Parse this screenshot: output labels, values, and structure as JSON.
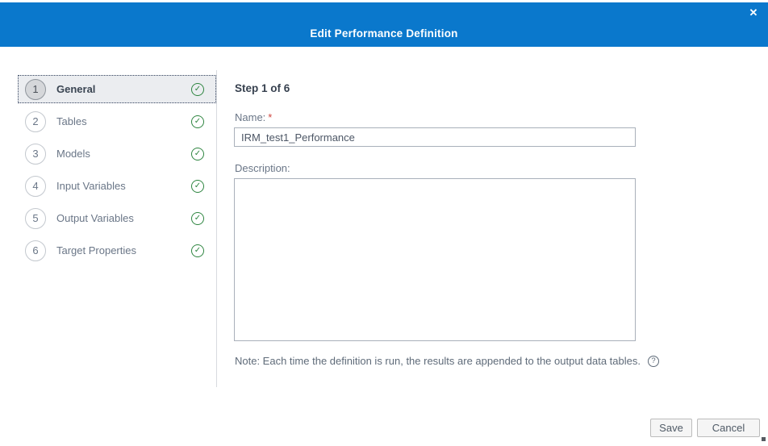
{
  "modal": {
    "title": "Edit Performance Definition",
    "close_icon": "✕"
  },
  "stepper": {
    "check_icon": "✓",
    "steps": [
      {
        "num": "1",
        "label": "General",
        "slug": "general",
        "selected": true
      },
      {
        "num": "2",
        "label": "Tables",
        "slug": "tables",
        "selected": false
      },
      {
        "num": "3",
        "label": "Models",
        "slug": "models",
        "selected": false
      },
      {
        "num": "4",
        "label": "Input Variables",
        "slug": "input-variables",
        "selected": false
      },
      {
        "num": "5",
        "label": "Output Variables",
        "slug": "output-variables",
        "selected": false
      },
      {
        "num": "6",
        "label": "Target Properties",
        "slug": "target-properties",
        "selected": false
      }
    ]
  },
  "content": {
    "step_indicator": "Step 1 of 6",
    "name_label": "Name:",
    "required_marker": "*",
    "name_value": "IRM_test1_Performance",
    "description_label": "Description:",
    "description_value": "",
    "note": "Note: Each time the definition is run, the results are appended to the output data tables.",
    "help_icon": "?"
  },
  "footer": {
    "save_label": "Save",
    "cancel_label": "Cancel"
  },
  "colors": {
    "header_blue": "#0a78cc",
    "check_green": "#2e8540",
    "required_red": "#d0453e",
    "selected_row_bg": "#ebedf0"
  }
}
